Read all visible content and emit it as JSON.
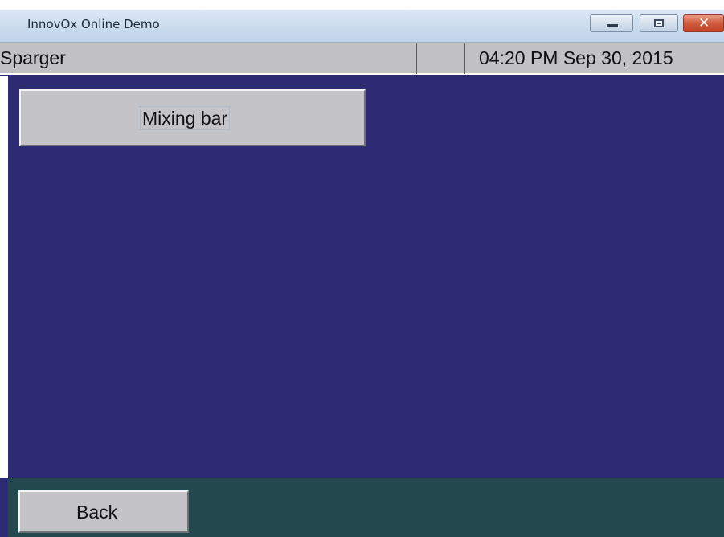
{
  "window": {
    "title": "InnovOx Online Demo",
    "controls": {
      "minimize_icon": "minimize-icon",
      "maximize_icon": "maximize-icon",
      "close_icon": "close-icon",
      "close_glyph": "✕"
    }
  },
  "status_bar": {
    "screen_name": "Sparger",
    "middle_field": "",
    "datetime": "04:20 PM Sep 30, 2015"
  },
  "main": {
    "buttons": [
      {
        "label": "Mixing bar"
      }
    ]
  },
  "footer": {
    "back_label": "Back"
  },
  "colors": {
    "background": "#2c2b73",
    "footer": "#23494f",
    "button_face": "#c4c4c8",
    "status_bar": "#c1c1c5",
    "close_button": "#c0432a"
  }
}
